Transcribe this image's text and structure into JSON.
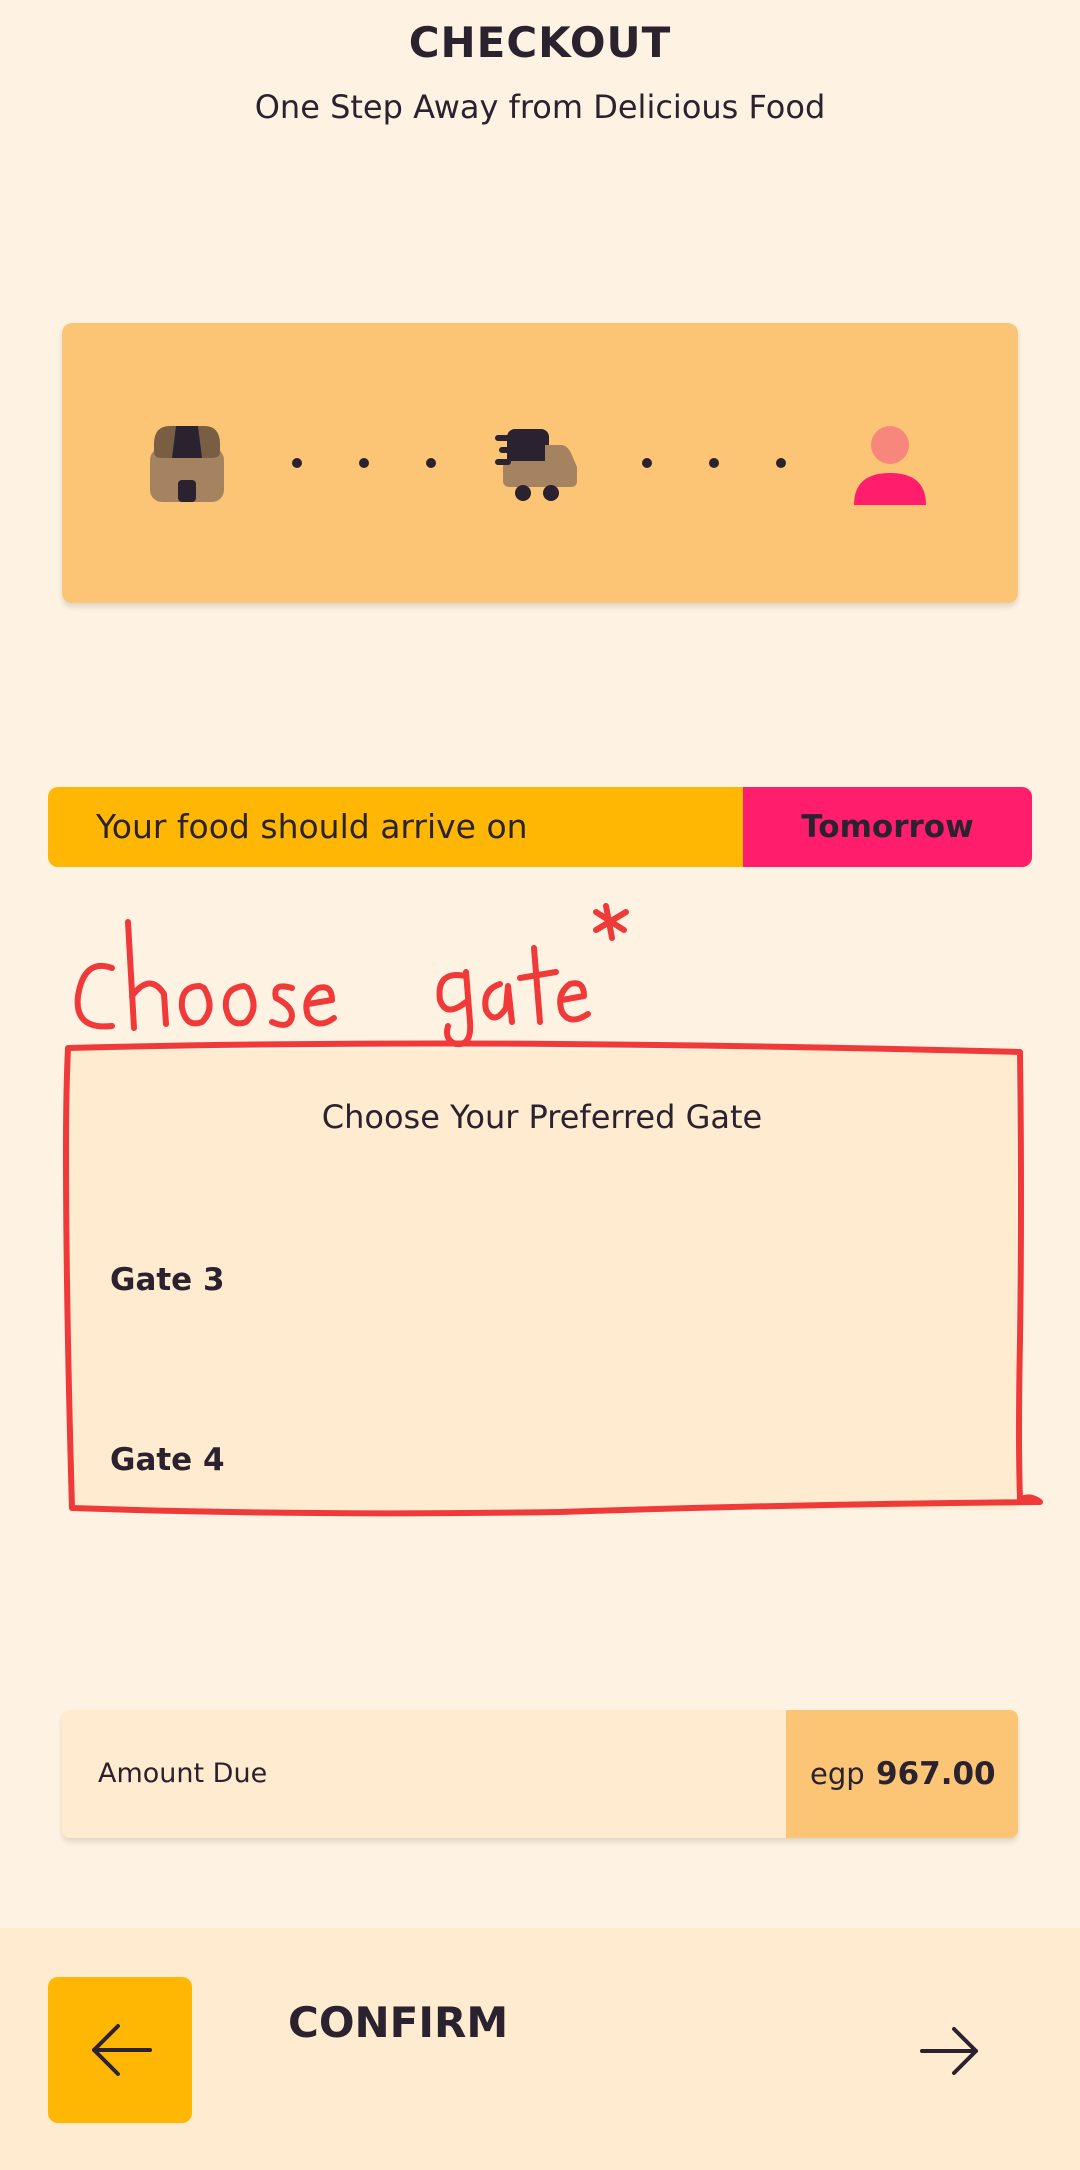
{
  "header": {
    "title": "CHECKOUT",
    "subtitle": "One Step Away from Delicious Food"
  },
  "progress": {
    "steps": [
      {
        "icon": "store-icon",
        "color": "#A68360"
      },
      {
        "icon": "delivery-truck-icon",
        "color": "#A68360"
      },
      {
        "icon": "customer-icon",
        "color": "#FF1D6C"
      }
    ]
  },
  "arrival": {
    "text": "Your food should arrive on",
    "day": "Tomorrow"
  },
  "annotation": {
    "text": "choose gate*",
    "color": "#F03A3A"
  },
  "gates": {
    "heading": "Choose Your Preferred Gate",
    "options": [
      "Gate 3",
      "Gate 4"
    ]
  },
  "amount": {
    "label": "Amount Due",
    "currency": "egp",
    "value": "967.00"
  },
  "footer": {
    "confirm_label": "CONFIRM",
    "back_icon": "arrow-left-icon",
    "next_icon": "arrow-right-icon"
  },
  "colors": {
    "background": "#FEF3E2",
    "accent_yellow": "#FFB703",
    "accent_pink": "#FF1D6C",
    "card_orange": "#FCC576",
    "card_cream": "#FFEBCF"
  }
}
